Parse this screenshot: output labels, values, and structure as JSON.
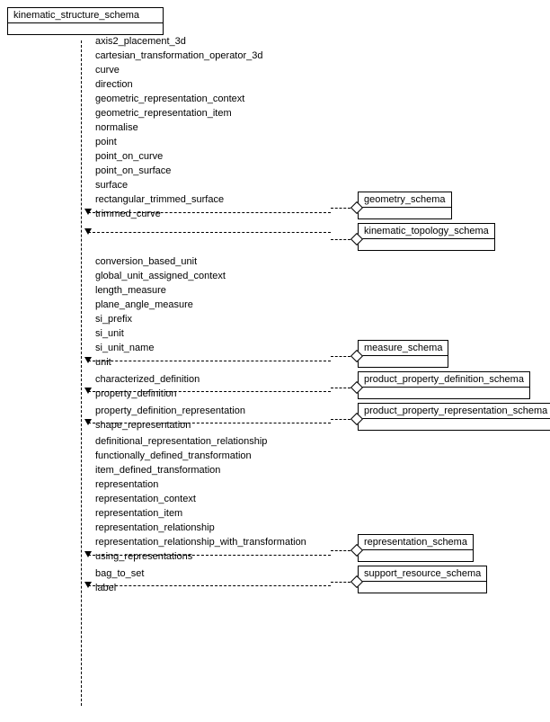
{
  "source": {
    "name": "kinematic_structure_schema"
  },
  "groups": [
    {
      "items": [
        "axis2_placement_3d",
        "cartesian_transformation_operator_3d",
        "curve",
        "direction",
        "geometric_representation_context",
        "geometric_representation_item",
        "normalise",
        "point",
        "point_on_curve",
        "point_on_surface",
        "surface",
        "rectangular_trimmed_surface",
        "trimmed_curve"
      ],
      "target": "geometry_schema"
    },
    {
      "items": [],
      "target": "kinematic_topology_schema"
    },
    {
      "items": [
        "conversion_based_unit",
        "global_unit_assigned_context",
        "length_measure",
        "plane_angle_measure",
        "si_prefix",
        "si_unit",
        "si_unit_name",
        "unit"
      ],
      "target": "measure_schema"
    },
    {
      "items": [
        "characterized_definition",
        "property_definition"
      ],
      "target": "product_property_definition_schema"
    },
    {
      "items": [
        "property_definition_representation",
        "shape_representation"
      ],
      "target": "product_property_representation_schema"
    },
    {
      "items": [
        "definitional_representation_relationship",
        "functionally_defined_transformation",
        "item_defined_transformation",
        "representation",
        "representation_context",
        "representation_item",
        "representation_relationship",
        "representation_relationship_with_transformation",
        "using_representations"
      ],
      "target": "representation_schema"
    },
    {
      "items": [
        "bag_to_set",
        "label"
      ],
      "target": "support_resource_schema"
    }
  ]
}
